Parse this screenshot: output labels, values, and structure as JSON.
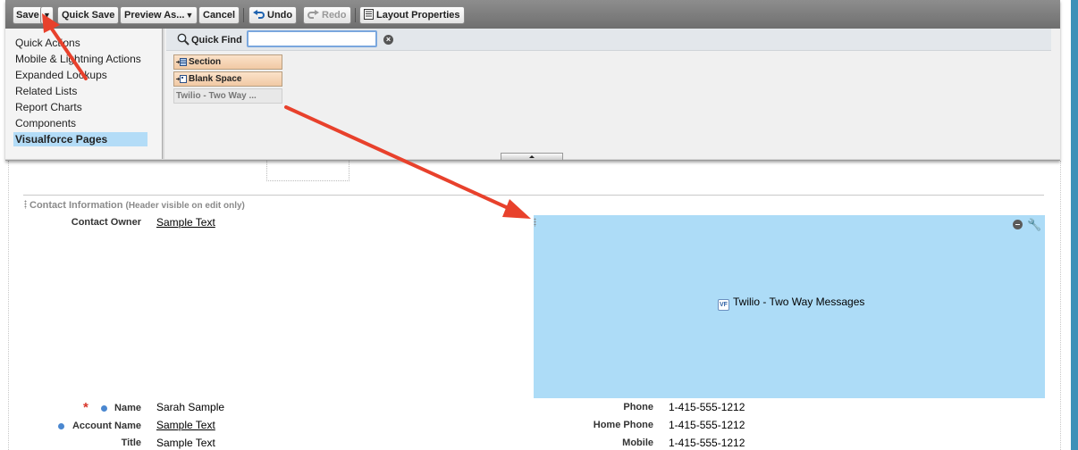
{
  "toolbar": {
    "save": "Save",
    "save_dropdown": "▼",
    "quick_save": "Quick Save",
    "preview_as": "Preview As...",
    "preview_dropdown": "▼",
    "cancel": "Cancel",
    "undo": "Undo",
    "redo": "Redo",
    "layout_properties": "Layout Properties"
  },
  "palette": {
    "categories": [
      {
        "label": "Quick Actions"
      },
      {
        "label": "Mobile & Lightning Actions"
      },
      {
        "label": "Expanded Lookups"
      },
      {
        "label": "Related Lists"
      },
      {
        "label": "Report Charts"
      },
      {
        "label": "Components"
      },
      {
        "label": "Visualforce Pages",
        "selected": true
      }
    ],
    "quick_find_label": "Quick Find",
    "quick_find_value": "",
    "items": [
      {
        "label": "Section"
      },
      {
        "label": "Blank Space"
      },
      {
        "label": "Twilio - Two Way ..."
      }
    ]
  },
  "section": {
    "title": "Contact Information",
    "subtitle": "(Header visible on edit only)"
  },
  "fields_left": [
    {
      "label": "Contact Owner",
      "value": "Sample Text",
      "link": true
    },
    {
      "label": "Name",
      "value": "Sarah Sample",
      "link": false,
      "required": true,
      "dot": true
    },
    {
      "label": "Account Name",
      "value": "Sample Text",
      "link": true,
      "dot": true
    },
    {
      "label": "Title",
      "value": "Sample Text",
      "link": false
    }
  ],
  "fields_right": [
    {
      "label": "Phone",
      "value": "1-415-555-1212"
    },
    {
      "label": "Home Phone",
      "value": "1-415-555-1212"
    },
    {
      "label": "Mobile",
      "value": "1-415-555-1212"
    }
  ],
  "vf_component": {
    "label": "Twilio - Two Way Messages",
    "badge": "VF"
  },
  "colors": {
    "toolbar": "#7d7d7d",
    "selected_category": "#b3dcf7",
    "vf_component_bg": "#addcf7",
    "annotation_arrow": "#e8412c",
    "required_marker": "#d8362a",
    "dot_marker": "#4a87d0"
  },
  "annotations": {
    "arrow_color": "#e8412c"
  }
}
